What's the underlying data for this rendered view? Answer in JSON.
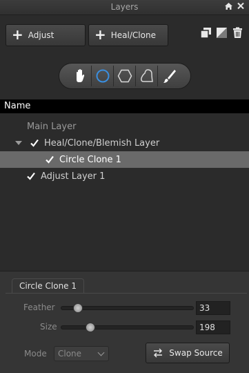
{
  "window": {
    "title": "Layers",
    "home_icon": "home-icon",
    "close_icon": "close-icon"
  },
  "toolbar": {
    "adjust_label": "Adjust",
    "heal_clone_label": "Heal/Clone",
    "right_icons": [
      "copy-layer-icon",
      "mask-icon",
      "trash-icon"
    ]
  },
  "tools": [
    "hand-tool",
    "circle-tool",
    "polygon-tool",
    "freehand-tool",
    "brush-tool"
  ],
  "layers": {
    "header": "Name",
    "rows": [
      {
        "label": "Main Layer",
        "checked": false,
        "expander": false,
        "selected": false,
        "indent": 1
      },
      {
        "label": "Heal/Clone/Blemish Layer",
        "checked": true,
        "expander": true,
        "selected": false,
        "indent": 0
      },
      {
        "label": "Circle Clone 1",
        "checked": true,
        "expander": false,
        "selected": true,
        "indent": 2
      },
      {
        "label": "Adjust Layer 1",
        "checked": true,
        "expander": false,
        "selected": false,
        "indent": 1
      }
    ]
  },
  "properties": {
    "tab_title": "Circle Clone 1",
    "feather_label": "Feather",
    "feather_value": "33",
    "feather_level": 0.1,
    "size_label": "Size",
    "size_value": "198",
    "size_level": 0.2,
    "mode_label": "Mode",
    "mode_value": "Clone",
    "swap_label": "Swap Source"
  },
  "colors": {
    "panel_bg": "#2b2b2b",
    "selected_row": "#6a6a6a",
    "header_bg": "#000000",
    "active_tool": "#3a8fe0"
  }
}
